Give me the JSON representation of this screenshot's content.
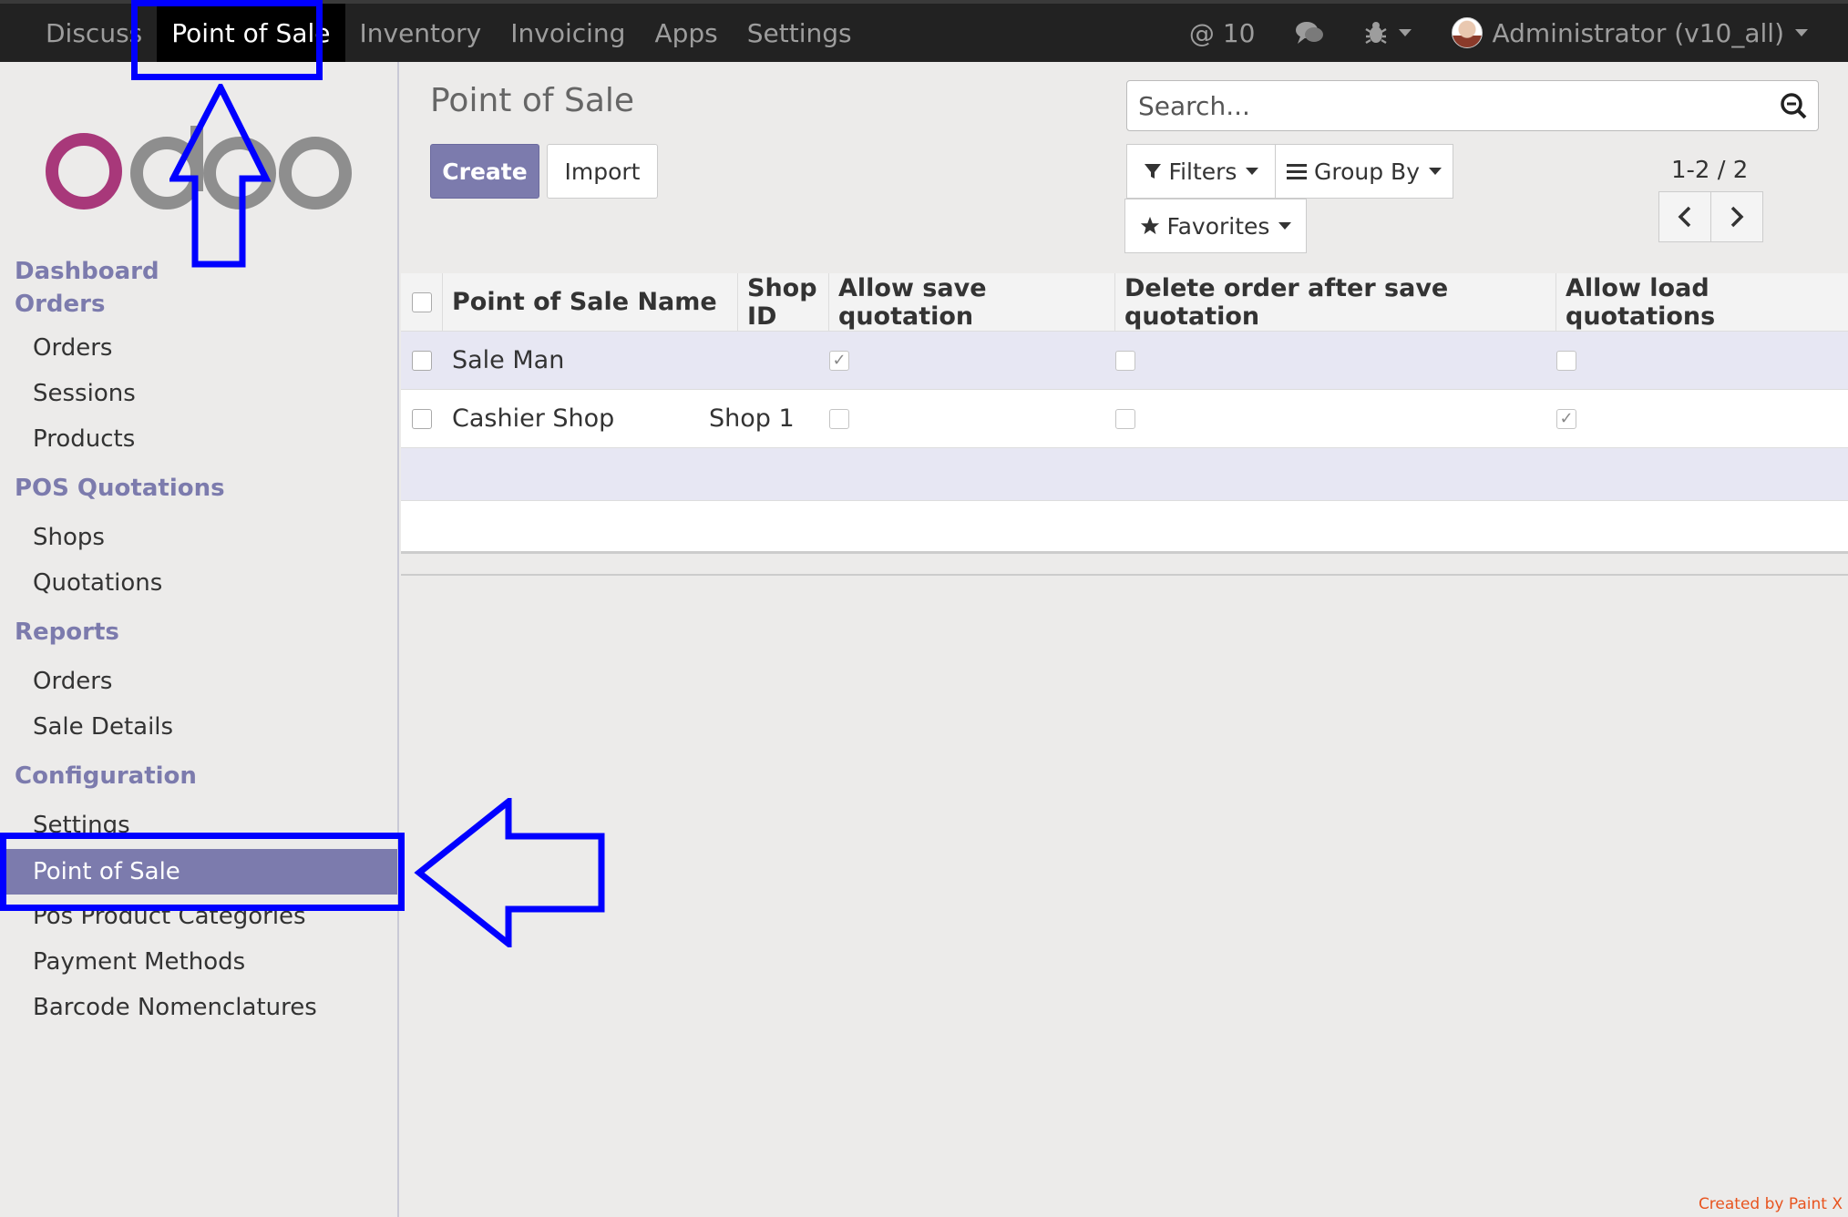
{
  "topnav": {
    "menus": [
      "Discuss",
      "Point of Sale",
      "Inventory",
      "Invoicing",
      "Apps",
      "Settings"
    ],
    "active": "Point of Sale",
    "mentions_count": "@ 10",
    "user_label": "Administrator (v10_all)"
  },
  "sidebar": {
    "logo_text": "odoo",
    "sections": [
      {
        "title": "Dashboard Orders",
        "items": [
          "Orders",
          "Sessions",
          "Products"
        ]
      },
      {
        "title": "POS Quotations",
        "items": [
          "Shops",
          "Quotations"
        ]
      },
      {
        "title": "Reports",
        "items": [
          "Orders",
          "Sale Details"
        ]
      },
      {
        "title": "Configuration",
        "items": [
          "Settings",
          "Point of Sale",
          "Pos Product Categories",
          "Payment Methods",
          "Barcode Nomenclatures"
        ]
      }
    ],
    "section_title_lines": {
      "dashboard_1": "Dashboard",
      "dashboard_2": "Orders"
    },
    "active_item": "Point of Sale"
  },
  "main": {
    "title": "Point of Sale",
    "create_label": "Create",
    "import_label": "Import",
    "search_placeholder": "Search...",
    "filters_label": "Filters",
    "groupby_label": "Group By",
    "favorites_label": "Favorites",
    "pager": "1-2 / 2"
  },
  "table": {
    "columns": [
      "Point of Sale Name",
      "Shop ID",
      "Allow save quotation",
      "Delete order after save quotation",
      "Allow load quotations"
    ],
    "rows": [
      {
        "name": "Sale Man",
        "shop": "",
        "allow_save": true,
        "delete_after": false,
        "allow_load": false
      },
      {
        "name": "Cashier Shop",
        "shop": "Shop 1",
        "allow_save": false,
        "delete_after": false,
        "allow_load": true
      }
    ]
  },
  "watermark": "Created by Paint X",
  "colors": {
    "accent": "#7c7bad",
    "navbar": "#222222",
    "annotation": "#0000ff"
  }
}
